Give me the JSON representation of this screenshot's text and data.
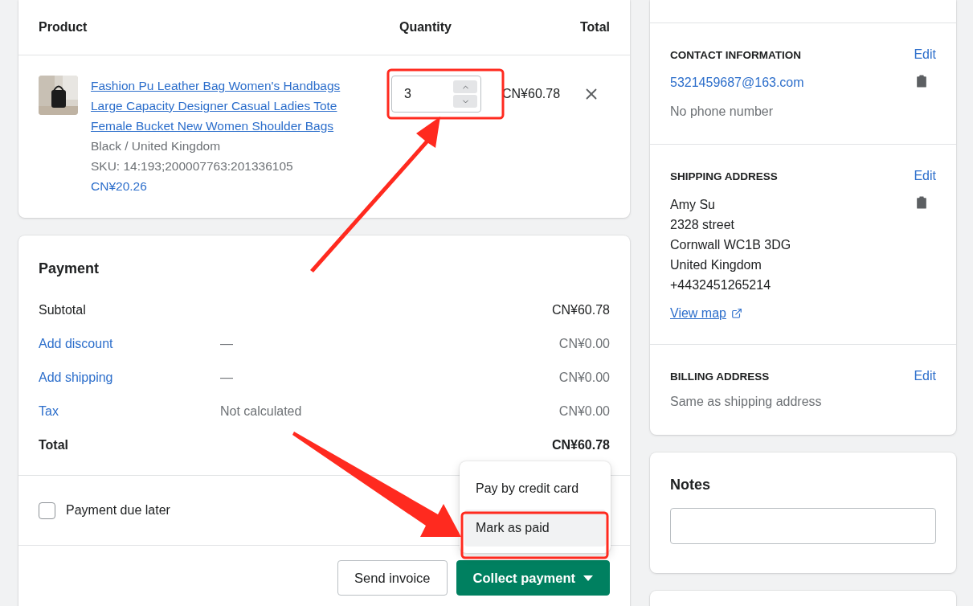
{
  "products_table": {
    "columns": [
      "Product",
      "Quantity",
      "Total"
    ],
    "rows": [
      {
        "title": "Fashion Pu Leather Bag Women's Handbags Large Capacity Designer Casual Ladies Tote Female Bucket New Women Shoulder Bags",
        "variant": "Black / United Kingdom",
        "sku": "SKU: 14:193;200007763:201336105",
        "price": "CN¥20.26",
        "quantity": "3",
        "total": "CN¥60.78"
      }
    ]
  },
  "payment": {
    "title": "Payment",
    "lines": [
      {
        "kind": "plain",
        "label": "Subtotal",
        "amount": "CN¥60.78"
      },
      {
        "kind": "link",
        "label": "Add discount",
        "note": "—",
        "amount": "CN¥0.00"
      },
      {
        "kind": "link",
        "label": "Add shipping",
        "note": "—",
        "amount": "CN¥0.00"
      },
      {
        "kind": "link",
        "label": "Tax",
        "note": "Not calculated",
        "amount": "CN¥0.00"
      },
      {
        "kind": "total",
        "label": "Total",
        "amount": "CN¥60.78"
      }
    ],
    "due_later": {
      "label": "Payment due later",
      "checked": false
    },
    "buttons": [
      {
        "kind": "secondary",
        "label": "Send invoice"
      },
      {
        "kind": "primary",
        "label": "Collect payment"
      }
    ],
    "menu": [
      {
        "label": "Pay by credit card",
        "selected": false
      },
      {
        "label": "Mark as paid",
        "selected": true
      }
    ]
  },
  "sidebar": {
    "contact": {
      "heading": "CONTACT INFORMATION",
      "edit": "Edit",
      "email": "5321459687@163.com",
      "phone": "No phone number"
    },
    "shipping": {
      "heading": "SHIPPING ADDRESS",
      "edit": "Edit",
      "lines": [
        "Amy Su",
        "2328 street",
        "Cornwall WC1B 3DG",
        "United Kingdom",
        "+4432451265214"
      ],
      "map_link": "View map"
    },
    "billing": {
      "heading": "BILLING ADDRESS",
      "edit": "Edit",
      "text": "Same as shipping address"
    },
    "notes": {
      "title": "Notes"
    }
  }
}
